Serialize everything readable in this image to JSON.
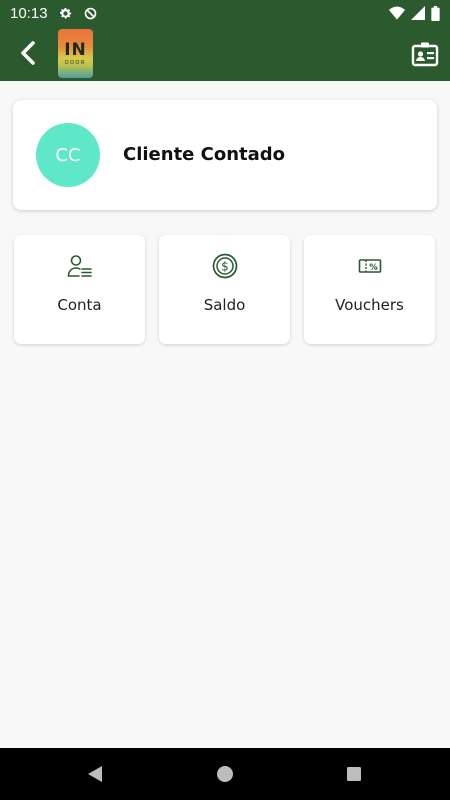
{
  "status_bar": {
    "time": "10:13",
    "icons": [
      "settings-gear-icon",
      "data-saver-icon",
      "wifi-icon",
      "signal-icon",
      "battery-icon"
    ]
  },
  "app_bar": {
    "back_icon": "back-chevron-icon",
    "logo": {
      "main": "IN",
      "sub": "DOOR"
    },
    "card_icon": "contact-card-icon",
    "background": "#2a5a2e"
  },
  "profile": {
    "initials": "CC",
    "name": "Cliente Contado",
    "avatar_color": "#5fe8c8"
  },
  "tiles": [
    {
      "label": "Conta",
      "icon": "account-icon"
    },
    {
      "label": "Saldo",
      "icon": "balance-dollar-icon"
    },
    {
      "label": "Vouchers",
      "icon": "voucher-icon"
    }
  ],
  "nav": [
    "back-triangle-icon",
    "home-circle-icon",
    "recents-square-icon"
  ]
}
